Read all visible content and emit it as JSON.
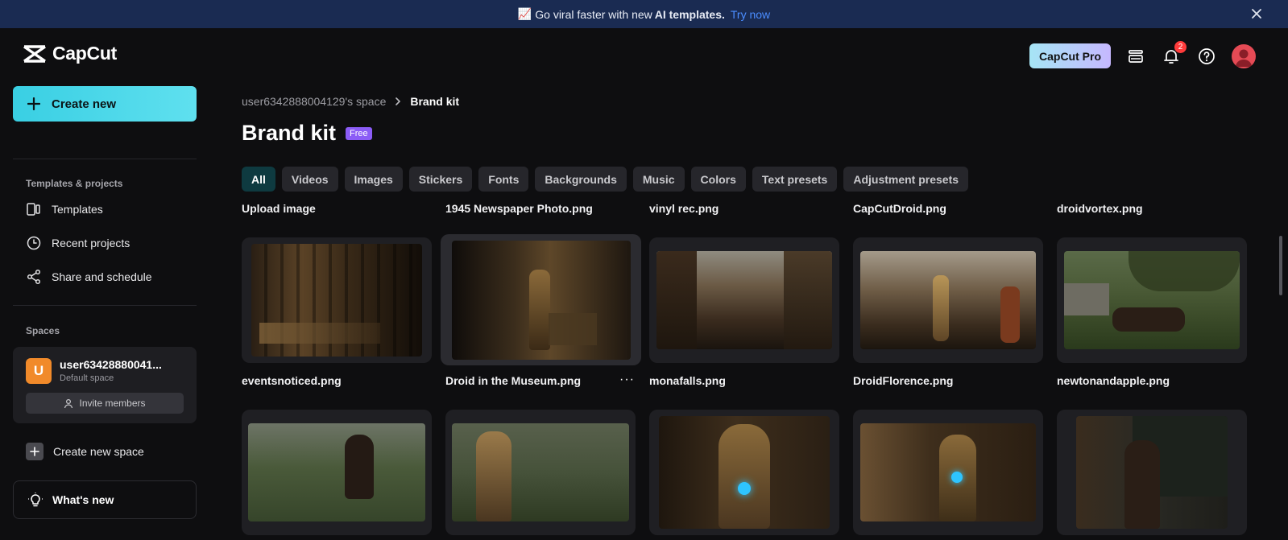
{
  "banner": {
    "emoji": "📈",
    "text_before": "Go viral faster with new",
    "strong": "AI templates.",
    "link": "Try now"
  },
  "header": {
    "logo_text": "CapCut",
    "pro_label": "CapCut Pro",
    "notification_count": "2"
  },
  "sidebar": {
    "create_new": "Create new",
    "templates_section": "Templates & projects",
    "items": [
      {
        "label": "Templates"
      },
      {
        "label": "Recent projects"
      },
      {
        "label": "Share and schedule"
      }
    ],
    "spaces_section": "Spaces",
    "space": {
      "initial": "U",
      "name": "user63428880041...",
      "sub": "Default space",
      "invite": "Invite members"
    },
    "create_space": "Create new space",
    "whats_new": "What's new"
  },
  "main": {
    "breadcrumb": {
      "root": "user6342888004129's space",
      "current": "Brand kit"
    },
    "title": "Brand kit",
    "badge": "Free",
    "tabs": [
      "All",
      "Videos",
      "Images",
      "Stickers",
      "Fonts",
      "Backgrounds",
      "Music",
      "Colors",
      "Text presets",
      "Adjustment presets"
    ],
    "active_tab": "All",
    "top_labels": [
      "Upload image",
      "1945 Newspaper Photo.png",
      "vinyl rec.png",
      "CapCutDroid.png",
      "droidvortex.png"
    ],
    "row1": [
      "eventsnoticed.png",
      "Droid in the Museum.png",
      "monafalls.png",
      "DroidFlorence.png",
      "newtonandapple.png"
    ],
    "more_symbol": "···"
  },
  "colors": {
    "accent": "#39cfe3",
    "banner_bg": "#1a2b52",
    "link": "#4b8dff",
    "badge": "#8b5cf6"
  }
}
